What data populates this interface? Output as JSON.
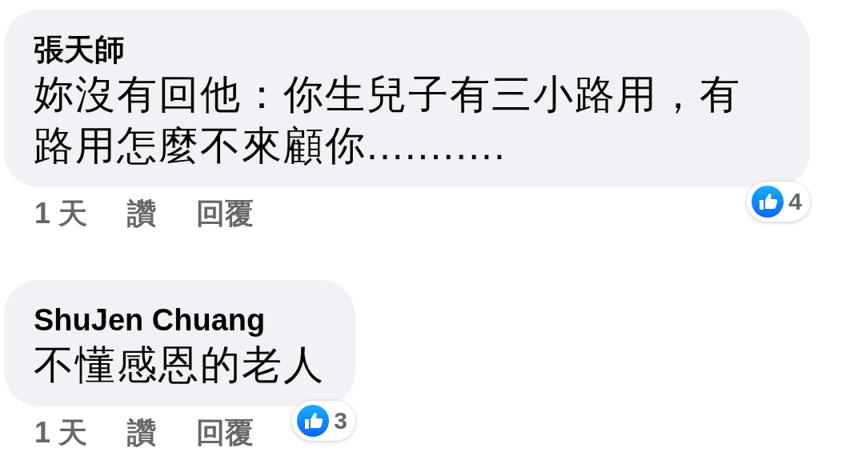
{
  "comments": [
    {
      "author": "張天師",
      "text": "妳沒有回他：你生兒子有三小路用，有路用怎麼不來顧你...........",
      "time": "1 天",
      "like_label": "讚",
      "reply_label": "回覆",
      "reaction_count": "4"
    },
    {
      "author": "ShuJen Chuang",
      "text": "不懂感恩的老人",
      "time": "1 天",
      "like_label": "讚",
      "reply_label": "回覆",
      "reaction_count": "3"
    }
  ]
}
